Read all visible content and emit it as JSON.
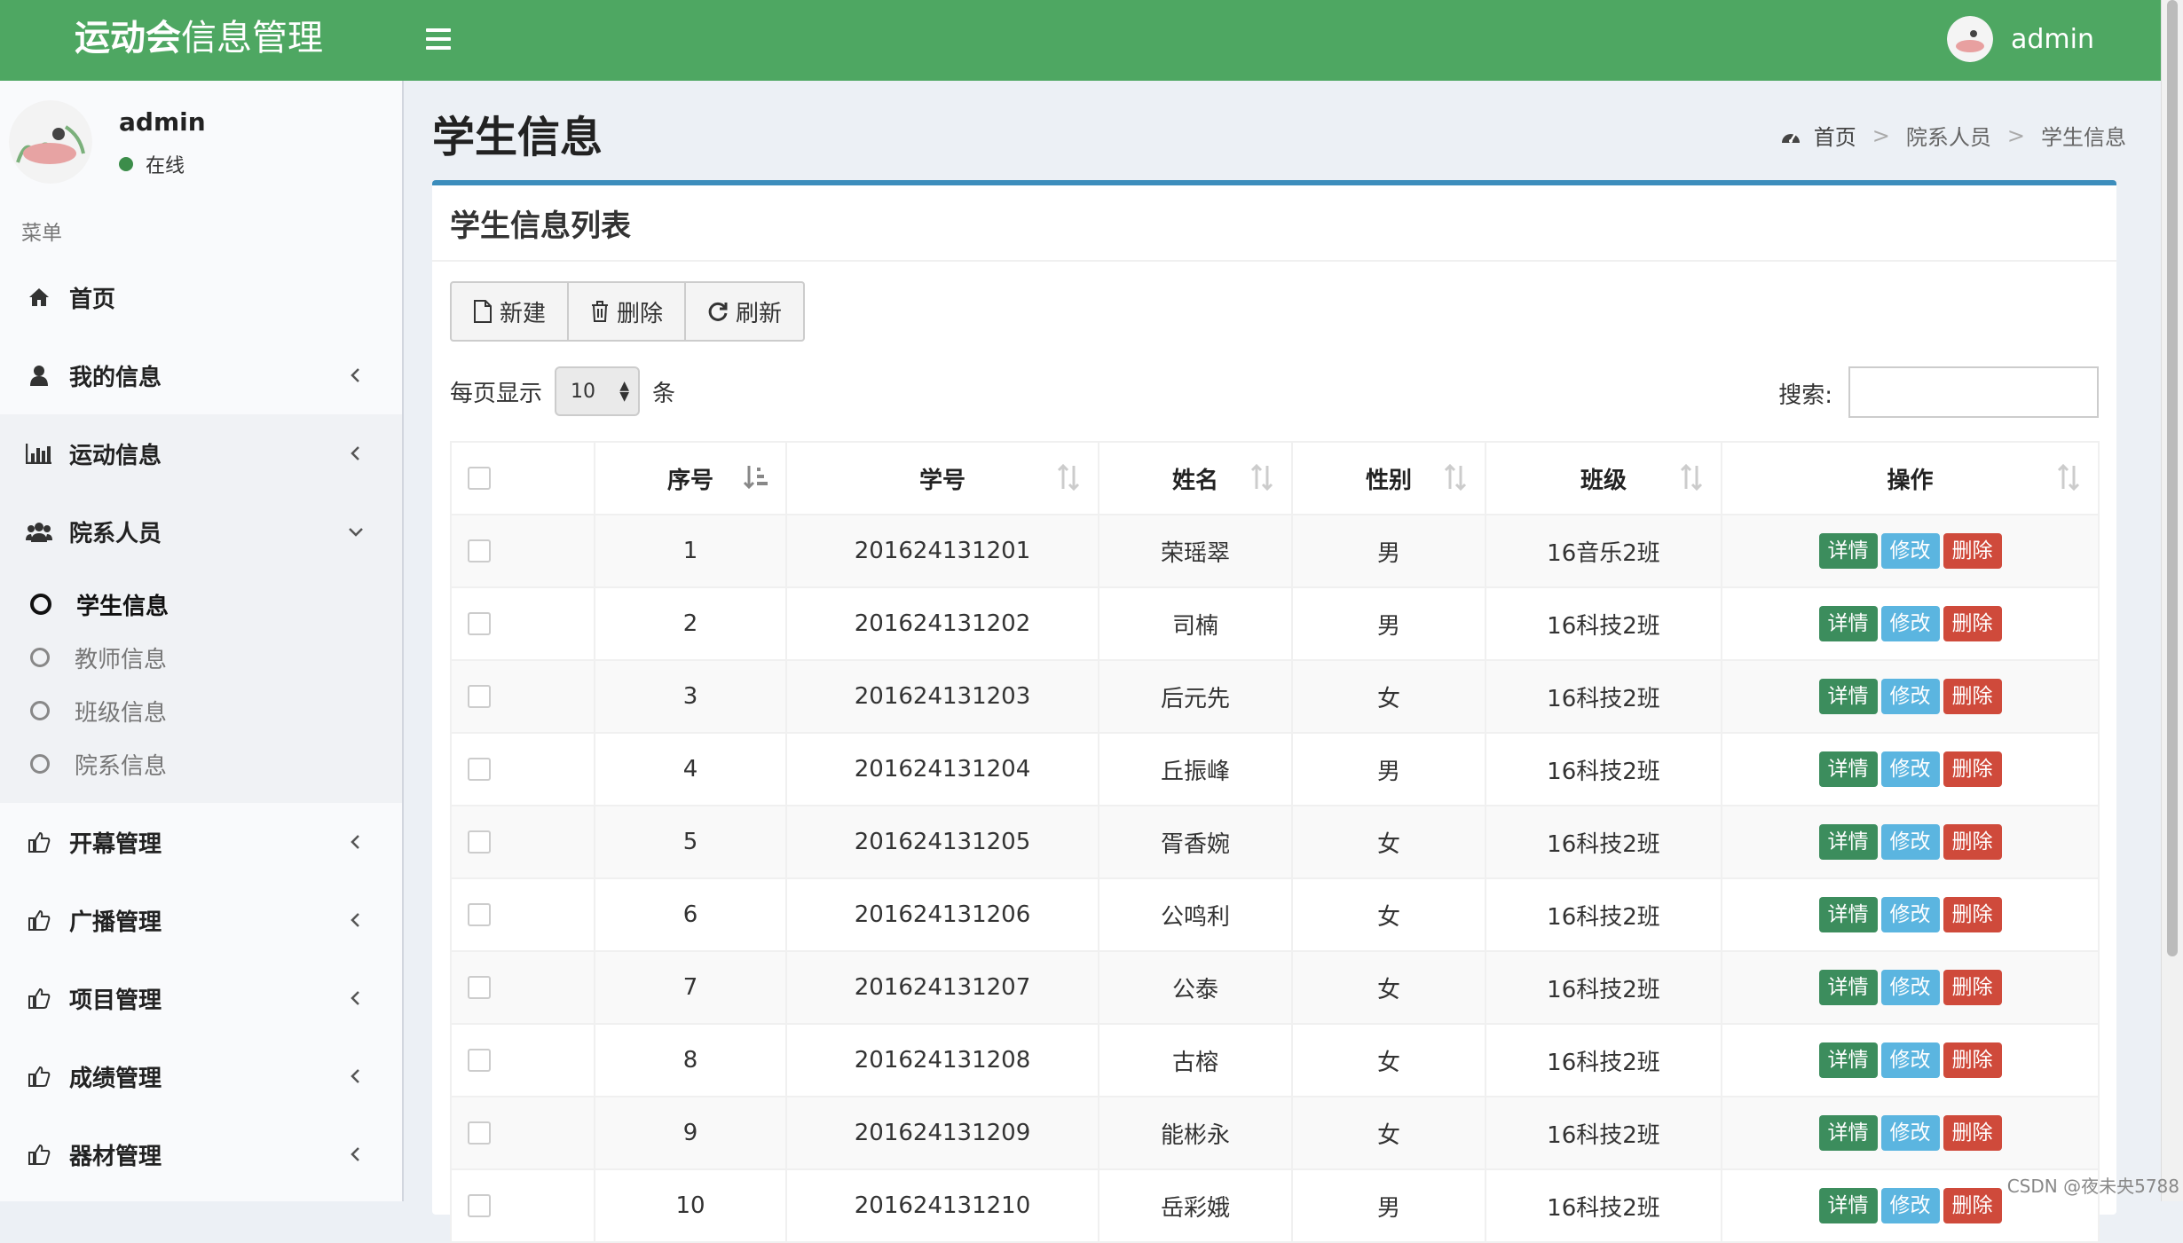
{
  "header": {
    "logo_bold": "运动会",
    "logo_light": "信息管理",
    "user": "admin"
  },
  "sidebar": {
    "user_name": "admin",
    "status": "在线",
    "menu_header": "菜单",
    "items": [
      {
        "label": "首页",
        "icon": "home-icon"
      },
      {
        "label": "我的信息",
        "icon": "user-icon"
      },
      {
        "label": "运动信息",
        "icon": "bar-chart-icon"
      },
      {
        "label": "院系人员",
        "icon": "users-icon"
      },
      {
        "label": "开幕管理",
        "icon": "thumbs-up-icon"
      },
      {
        "label": "广播管理",
        "icon": "thumbs-up-icon"
      },
      {
        "label": "项目管理",
        "icon": "thumbs-up-icon"
      },
      {
        "label": "成绩管理",
        "icon": "thumbs-up-icon"
      },
      {
        "label": "器材管理",
        "icon": "thumbs-up-icon"
      }
    ],
    "submenu": [
      "学生信息",
      "教师信息",
      "班级信息",
      "院系信息"
    ]
  },
  "page": {
    "title": "学生信息",
    "breadcrumb": [
      "首页",
      "院系人员",
      "学生信息"
    ]
  },
  "box": {
    "title": "学生信息列表",
    "buttons": {
      "new": "新建",
      "delete": "删除",
      "refresh": "刷新"
    },
    "page_len_prefix": "每页显示",
    "page_len_value": "10",
    "page_len_suffix": "条",
    "search_label": "搜索:"
  },
  "table": {
    "headers": [
      "序号",
      "学号",
      "姓名",
      "性别",
      "班级",
      "操作"
    ],
    "actions": {
      "view": "详情",
      "edit": "修改",
      "delete": "删除"
    },
    "rows": [
      [
        "1",
        "201624131201",
        "荣瑶翠",
        "男",
        "16音乐2班"
      ],
      [
        "2",
        "201624131202",
        "司楠",
        "男",
        "16科技2班"
      ],
      [
        "3",
        "201624131203",
        "后元先",
        "女",
        "16科技2班"
      ],
      [
        "4",
        "201624131204",
        "丘振峰",
        "男",
        "16科技2班"
      ],
      [
        "5",
        "201624131205",
        "胥香婉",
        "女",
        "16科技2班"
      ],
      [
        "6",
        "201624131206",
        "公鸣利",
        "女",
        "16科技2班"
      ],
      [
        "7",
        "201624131207",
        "公泰",
        "女",
        "16科技2班"
      ],
      [
        "8",
        "201624131208",
        "古榕",
        "女",
        "16科技2班"
      ],
      [
        "9",
        "201624131209",
        "能彬永",
        "女",
        "16科技2班"
      ],
      [
        "10",
        "201624131210",
        "岳彩娥",
        "男",
        "16科技2班"
      ]
    ]
  },
  "watermark": "CSDN @夜未央5788",
  "colors": {
    "header": "#4ea762",
    "box_border": "#3c8dbc",
    "view": "#3c8d5d",
    "edit": "#5bb5e0",
    "delete": "#cf4a3b"
  }
}
